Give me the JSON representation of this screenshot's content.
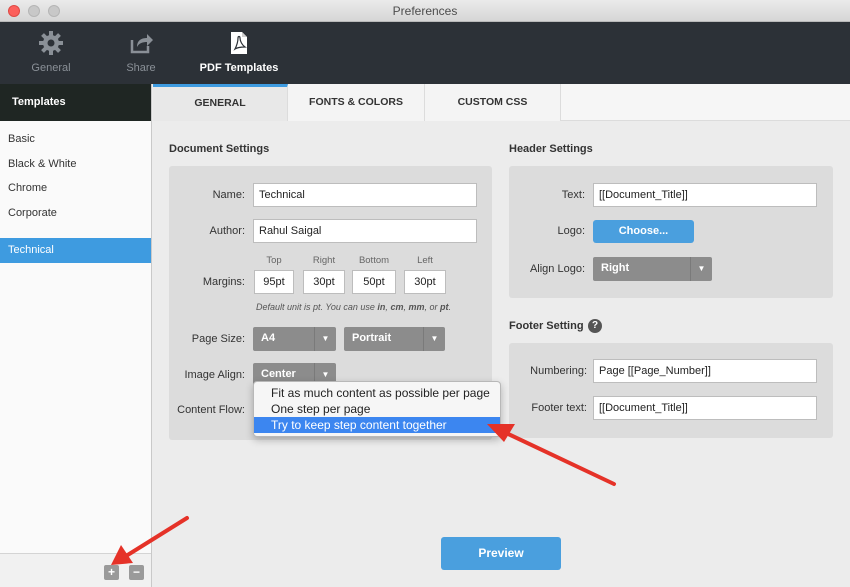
{
  "window": {
    "title": "Preferences"
  },
  "toolbar": {
    "items": [
      {
        "label": "General",
        "icon": "gear-icon"
      },
      {
        "label": "Share",
        "icon": "share-icon"
      },
      {
        "label": "PDF Templates",
        "icon": "pdf-icon"
      }
    ],
    "active_index": 2
  },
  "sidebar": {
    "header": "Templates",
    "items": [
      "Basic",
      "Black & White",
      "Chrome",
      "Corporate",
      "Technical"
    ],
    "selected": "Technical",
    "add_label": "+",
    "remove_label": "−"
  },
  "tabs": [
    "GENERAL",
    "FONTS & COLORS",
    "CUSTOM CSS"
  ],
  "document": {
    "title": "Document Settings",
    "name_label": "Name:",
    "name_value": "Technical",
    "author_label": "Author:",
    "author_value": "Rahul Saigal",
    "margins_label": "Margins:",
    "margins": [
      {
        "label": "Top",
        "value": "95pt"
      },
      {
        "label": "Right",
        "value": "30pt"
      },
      {
        "label": "Bottom",
        "value": "50pt"
      },
      {
        "label": "Left",
        "value": "30pt"
      }
    ],
    "hint_pre": "Default unit is pt. You can use ",
    "hint_in": "in",
    "hint_sep1": ", ",
    "hint_cm": "cm",
    "hint_sep2": ", ",
    "hint_mm": "mm",
    "hint_sep3": ", or ",
    "hint_pt": "pt",
    "hint_end": ".",
    "page_size_label": "Page Size:",
    "page_size_value": "A4",
    "orientation_value": "Portrait",
    "image_align_label": "Image Align:",
    "image_align_value": "Center",
    "content_flow_label": "Content Flow:",
    "content_flow_options": [
      "Fit as much content as possible per page",
      "One step per page",
      "Try to keep step content together"
    ],
    "content_flow_highlighted": 2
  },
  "header": {
    "title": "Header Settings",
    "text_label": "Text:",
    "text_value": "[[Document_Title]]",
    "logo_label": "Logo:",
    "logo_button": "Choose...",
    "align_logo_label": "Align Logo:",
    "align_logo_value": "Right"
  },
  "footer": {
    "title": "Footer Setting",
    "help_icon": "?",
    "numbering_label": "Numbering:",
    "numbering_value": "Page [[Page_Number]]",
    "footer_text_label": "Footer text:",
    "footer_text_value": "[[Document_Title]]"
  },
  "preview_button": "Preview",
  "colors": {
    "accent": "#3e9be0",
    "toolbar": "#2c3137",
    "arrow": "#e53228"
  }
}
